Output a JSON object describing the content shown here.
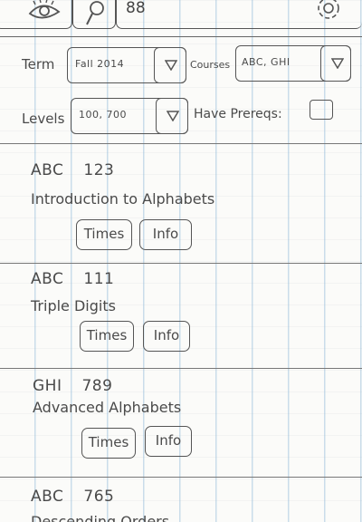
{
  "toolbar": {
    "buttons": [
      {
        "name": "eye-icon"
      },
      {
        "name": "search-icon"
      },
      {
        "name": "grid-icon",
        "label": "88"
      },
      {
        "name": "gear-icon"
      }
    ]
  },
  "filters": {
    "term_label": "Term",
    "term_value": "Fall 2014",
    "courses_label": "Courses",
    "courses_value": "ABC, GHI",
    "levels_label": "Levels",
    "levels_value": "100, 700",
    "prereqs_label": "Have Prereqs",
    "prereqs_colon": ":",
    "prereqs_checked": false
  },
  "courses": [
    {
      "dept": "ABC",
      "number": "123",
      "title": "Introduction to Alphabets",
      "times_label": "Times",
      "info_label": "Info"
    },
    {
      "dept": "ABC",
      "number": "111",
      "title": "Triple Digits",
      "times_label": "Times",
      "info_label": "Info"
    },
    {
      "dept": "GHI",
      "number": "789",
      "title": "Advanced Alphabets",
      "times_label": "Times",
      "info_label": "Info"
    },
    {
      "dept": "ABC",
      "number": "765",
      "title": "Descending Orders"
    }
  ]
}
